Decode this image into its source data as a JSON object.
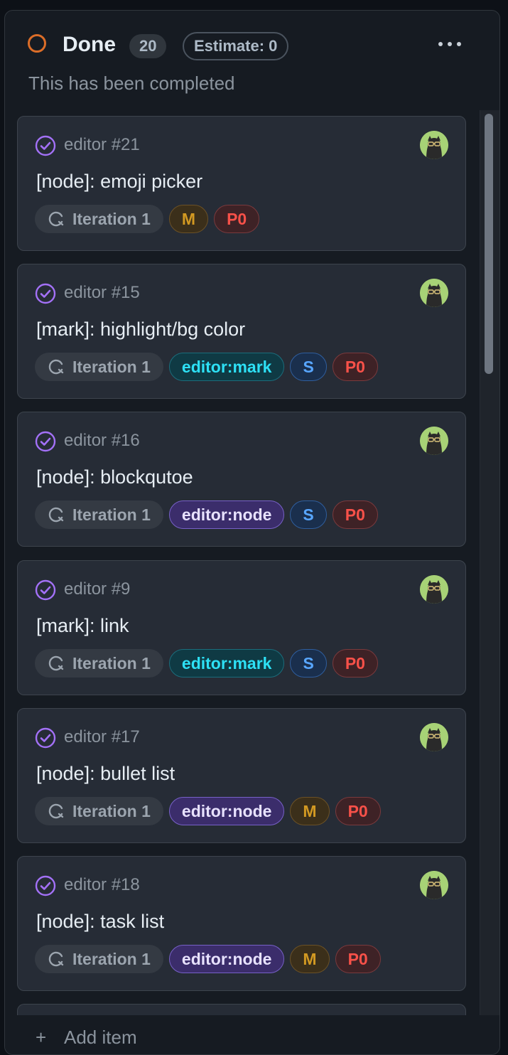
{
  "column": {
    "title": "Done",
    "count": "20",
    "estimate": "Estimate: 0",
    "description": "This has been completed",
    "status_color": "#db6d28",
    "add_item_label": "Add item"
  },
  "cards": [
    {
      "repo": "editor #21",
      "title": "[node]: emoji picker",
      "labels": [
        {
          "kind": "iteration",
          "text": "Iteration 1"
        },
        {
          "kind": "size-M",
          "text": "M"
        },
        {
          "kind": "priority",
          "text": "P0"
        }
      ]
    },
    {
      "repo": "editor #15",
      "title": "[mark]: highlight/bg color",
      "labels": [
        {
          "kind": "iteration",
          "text": "Iteration 1"
        },
        {
          "kind": "editor-mark",
          "text": "editor:mark"
        },
        {
          "kind": "size-S",
          "text": "S"
        },
        {
          "kind": "priority",
          "text": "P0"
        }
      ]
    },
    {
      "repo": "editor #16",
      "title": "[node]: blockqutoe",
      "labels": [
        {
          "kind": "iteration",
          "text": "Iteration 1"
        },
        {
          "kind": "editor-node",
          "text": "editor:node"
        },
        {
          "kind": "size-S",
          "text": "S"
        },
        {
          "kind": "priority",
          "text": "P0"
        }
      ]
    },
    {
      "repo": "editor #9",
      "title": "[mark]: link",
      "labels": [
        {
          "kind": "iteration",
          "text": "Iteration 1"
        },
        {
          "kind": "editor-mark",
          "text": "editor:mark"
        },
        {
          "kind": "size-S",
          "text": "S"
        },
        {
          "kind": "priority",
          "text": "P0"
        }
      ]
    },
    {
      "repo": "editor #17",
      "title": "[node]: bullet list",
      "labels": [
        {
          "kind": "iteration",
          "text": "Iteration 1"
        },
        {
          "kind": "editor-node",
          "text": "editor:node"
        },
        {
          "kind": "size-M",
          "text": "M"
        },
        {
          "kind": "priority",
          "text": "P0"
        }
      ]
    },
    {
      "repo": "editor #18",
      "title": "[node]: task list",
      "labels": [
        {
          "kind": "iteration",
          "text": "Iteration 1"
        },
        {
          "kind": "editor-node",
          "text": "editor:node"
        },
        {
          "kind": "size-M",
          "text": "M"
        },
        {
          "kind": "priority",
          "text": "P0"
        }
      ]
    }
  ],
  "icons": {
    "status": "circle-outline-icon",
    "done": "check-circle-icon",
    "iteration": "iteration-icon",
    "more": "kebab-horizontal-icon",
    "add": "plus-icon",
    "avatar": "user-avatar"
  },
  "colors": {
    "done_icon": "#a371f7",
    "priority": "#f85149",
    "size_M": "#d29922",
    "size_S": "#58a6ff",
    "editor_mark": "#2de0f5",
    "editor_node": "#e8e2ff"
  }
}
